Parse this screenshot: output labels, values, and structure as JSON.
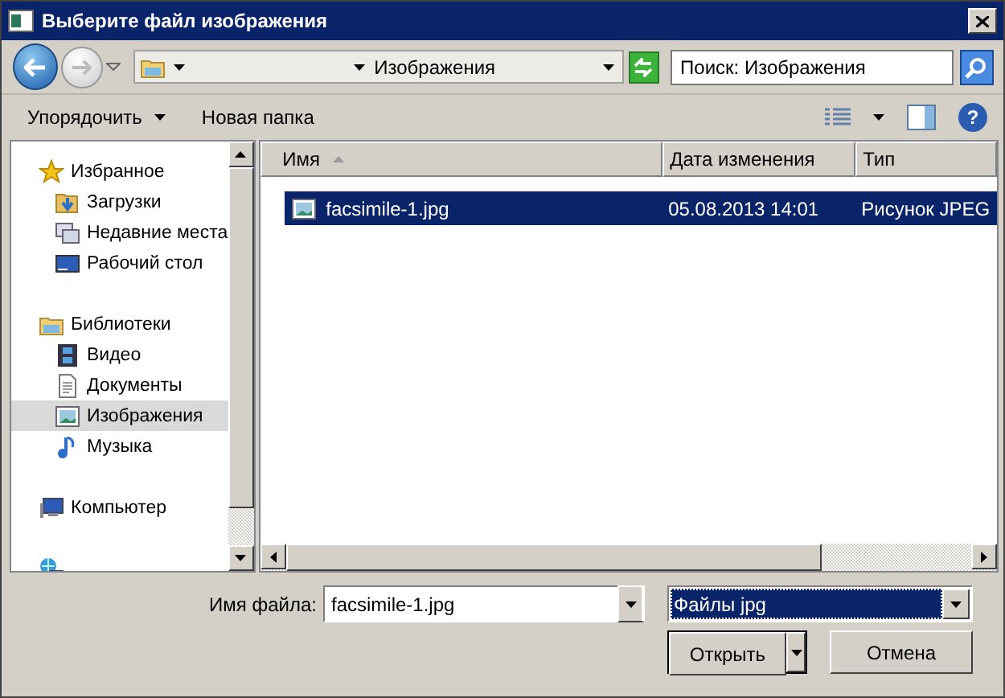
{
  "window": {
    "title": "Выберите файл изображения"
  },
  "address": {
    "location": "Изображения"
  },
  "search": {
    "placeholder": "Поиск: Изображения"
  },
  "command_bar": {
    "buttons": [
      {
        "label": "Упорядочить",
        "dropdown": true
      },
      {
        "label": "Новая папка",
        "dropdown": false
      }
    ],
    "help": "?"
  },
  "nav": {
    "groups": [
      {
        "label": "Избранное",
        "children": [
          {
            "label": "Загрузки",
            "selected": false
          },
          {
            "label": "Недавние места",
            "selected": false
          },
          {
            "label": "Рабочий стол",
            "selected": false
          }
        ]
      },
      {
        "label": "Библиотеки",
        "children": [
          {
            "label": "Видео",
            "selected": false
          },
          {
            "label": "Документы",
            "selected": false
          },
          {
            "label": "Изображения",
            "selected": true
          },
          {
            "label": "Музыка",
            "selected": false
          }
        ]
      },
      {
        "label": "Компьютер"
      }
    ]
  },
  "file_list": {
    "columns": [
      {
        "label": "Имя",
        "sorted": true
      },
      {
        "label": "Дата изменения",
        "sorted": false
      },
      {
        "label": "Тип",
        "sorted": false
      }
    ],
    "rows": [
      {
        "name": "facsimile-1.jpg",
        "date": "05.08.2013 14:01",
        "type": "Рисунок JPEG",
        "selected": true
      }
    ]
  },
  "footer": {
    "filename_label": "Имя файла:",
    "filename": "facsimile-1.jpg",
    "filter": "Файлы jpg",
    "buttons": [
      {
        "label": "Открыть",
        "kind": "split"
      },
      {
        "label": "Отмена",
        "kind": "plain"
      }
    ]
  }
}
